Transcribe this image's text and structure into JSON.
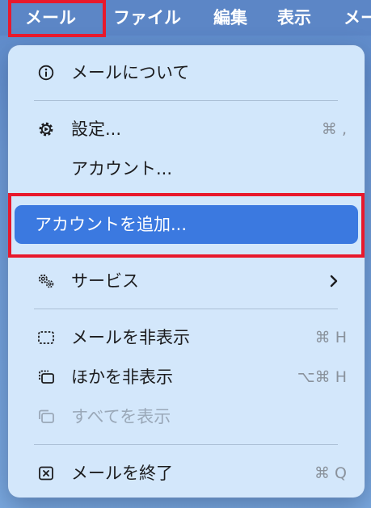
{
  "menubar": {
    "mail": "メール",
    "file": "ファイル",
    "edit": "編集",
    "view": "表示",
    "more": "メー"
  },
  "menu": {
    "about": {
      "label": "メールについて",
      "icon": "info-circle-icon"
    },
    "settings": {
      "label": "設定...",
      "shortcut": "⌘ ,",
      "icon": "gear-icon"
    },
    "accounts": {
      "label": "アカウント..."
    },
    "add_account": {
      "label": "アカウントを追加..."
    },
    "services": {
      "label": "サービス",
      "icon": "gears-icon"
    },
    "hide_mail": {
      "label": "メールを非表示",
      "shortcut": "⌘ H",
      "icon": "dashed-window-icon"
    },
    "hide_others": {
      "label": "ほかを非表示",
      "shortcut": "⌥⌘ H",
      "icon": "stacked-windows-icon"
    },
    "show_all": {
      "label": "すべてを表示",
      "icon": "windows-icon"
    },
    "quit": {
      "label": "メールを終了",
      "shortcut": "⌘ Q",
      "icon": "x-square-icon"
    }
  },
  "colors": {
    "highlight_border": "#e8192c",
    "selected_bg": "#3b79e0",
    "menubar_bg": "#5c86c6"
  }
}
